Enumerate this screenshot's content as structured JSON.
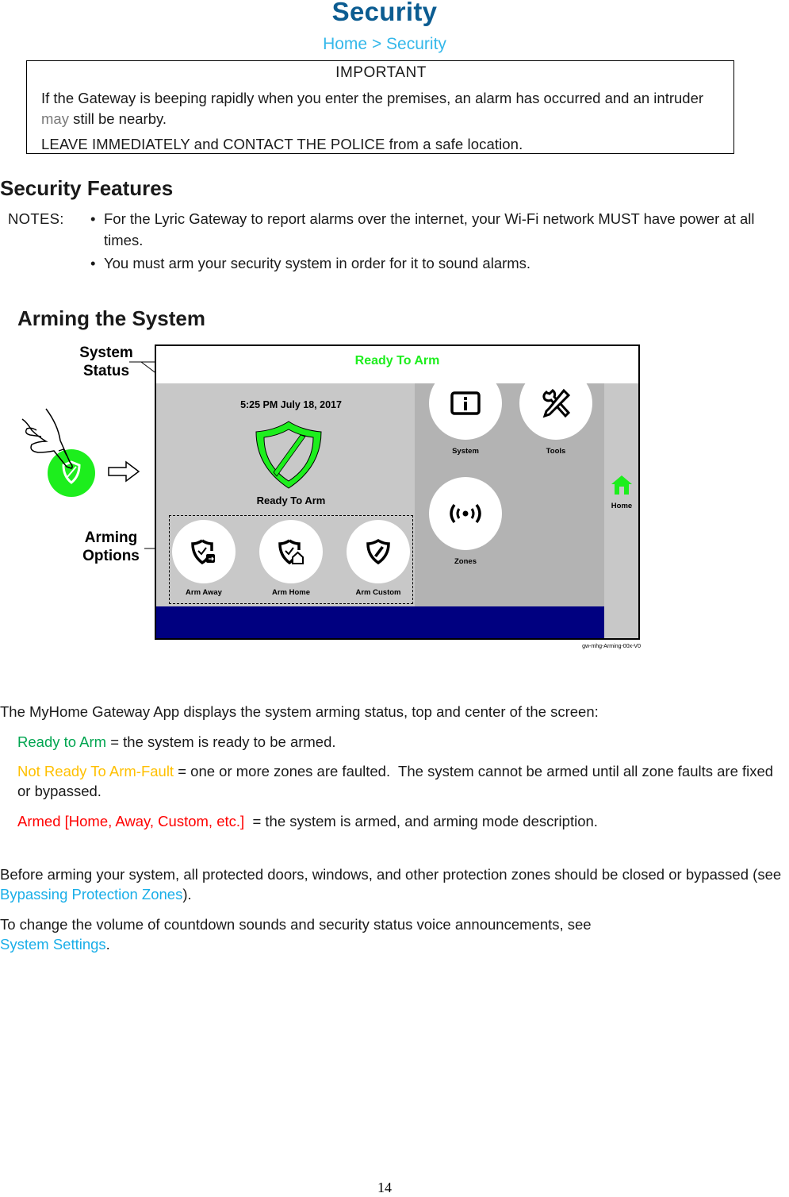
{
  "header": {
    "title": "Security",
    "breadcrumb": {
      "home": "Home",
      "separator": " > ",
      "current": "Security"
    }
  },
  "important": {
    "title": "IMPORTANT",
    "body_before": "If the Gateway is beeping rapidly when you enter the premises, an alarm has occurred and an intruder ",
    "body_emph": "may",
    "body_after": " still be nearby.",
    "warning": "LEAVE IMMEDIATELY and CONTACT THE POLICE from a safe location."
  },
  "features": {
    "heading": "Security Features",
    "notes_label": "NOTES:",
    "bullet_glyph": "•",
    "notes": [
      "For the Lyric Gateway to report alarms over the internet, your Wi-Fi network MUST have power at all times.",
      "You must arm your security system in order for it to sound alarms."
    ]
  },
  "arming": {
    "heading": "Arming the System",
    "figure": {
      "callouts": {
        "system_status": [
          "System",
          "Status"
        ],
        "arming_options": [
          "Arming",
          "Options"
        ]
      },
      "screen": {
        "header_status": "Ready To Arm",
        "datetime": "5:25 PM July 18, 2017",
        "main_status": "Ready To Arm",
        "arming_options": [
          {
            "label": "Arm Away",
            "icon": "shield-check-away-icon"
          },
          {
            "label": "Arm Home",
            "icon": "shield-check-home-icon"
          },
          {
            "label": "Arm Custom",
            "icon": "shield-custom-icon"
          }
        ],
        "tiles": [
          {
            "label": "System",
            "icon": "info-icon"
          },
          {
            "label": "Tools",
            "icon": "tools-icon"
          },
          {
            "label": "Zones",
            "icon": "zones-signal-icon"
          }
        ],
        "sidebar_home_label": "Home"
      },
      "figure_id": "gw-mhg-Arming-00x-V0",
      "colors": {
        "status_green": "#1dee1d",
        "footer_navy": "#000080",
        "panel_gray": "#c8c8c8",
        "panel_dark_gray": "#b3b3b3"
      }
    }
  },
  "status_descriptions": {
    "intro": "The MyHome Gateway App displays the system arming status, top and center of the screen:",
    "items": [
      {
        "term": "Ready to Arm",
        "desc": " = the system is ready to be armed.",
        "color": "#00a550"
      },
      {
        "term": "Not Ready To Arm-Fault",
        "desc": " = one or more zones are faulted.  The system cannot be armed until all zone faults are fixed or bypassed.",
        "color": "#ffc000"
      },
      {
        "term": "Armed [Home, Away, Custom, etc.]",
        "desc": "  = the system is armed, and arming mode description.",
        "color": "#ff0000"
      }
    ]
  },
  "before_arming": {
    "text_before": "Before arming your system, all protected doors, windows, and other protection zones should be closed or bypassed (see ",
    "link": "Bypassing Protection Zones",
    "text_after": ")."
  },
  "volume": {
    "text_before": "To change the volume of countdown sounds and security status voice announcements, see ",
    "link": "System Settings",
    "text_after": "."
  },
  "page_number": "14",
  "theme": {
    "title_color": "#0b5c91",
    "breadcrumb_color": "#35b8ea",
    "link_color": "#19aee8"
  }
}
